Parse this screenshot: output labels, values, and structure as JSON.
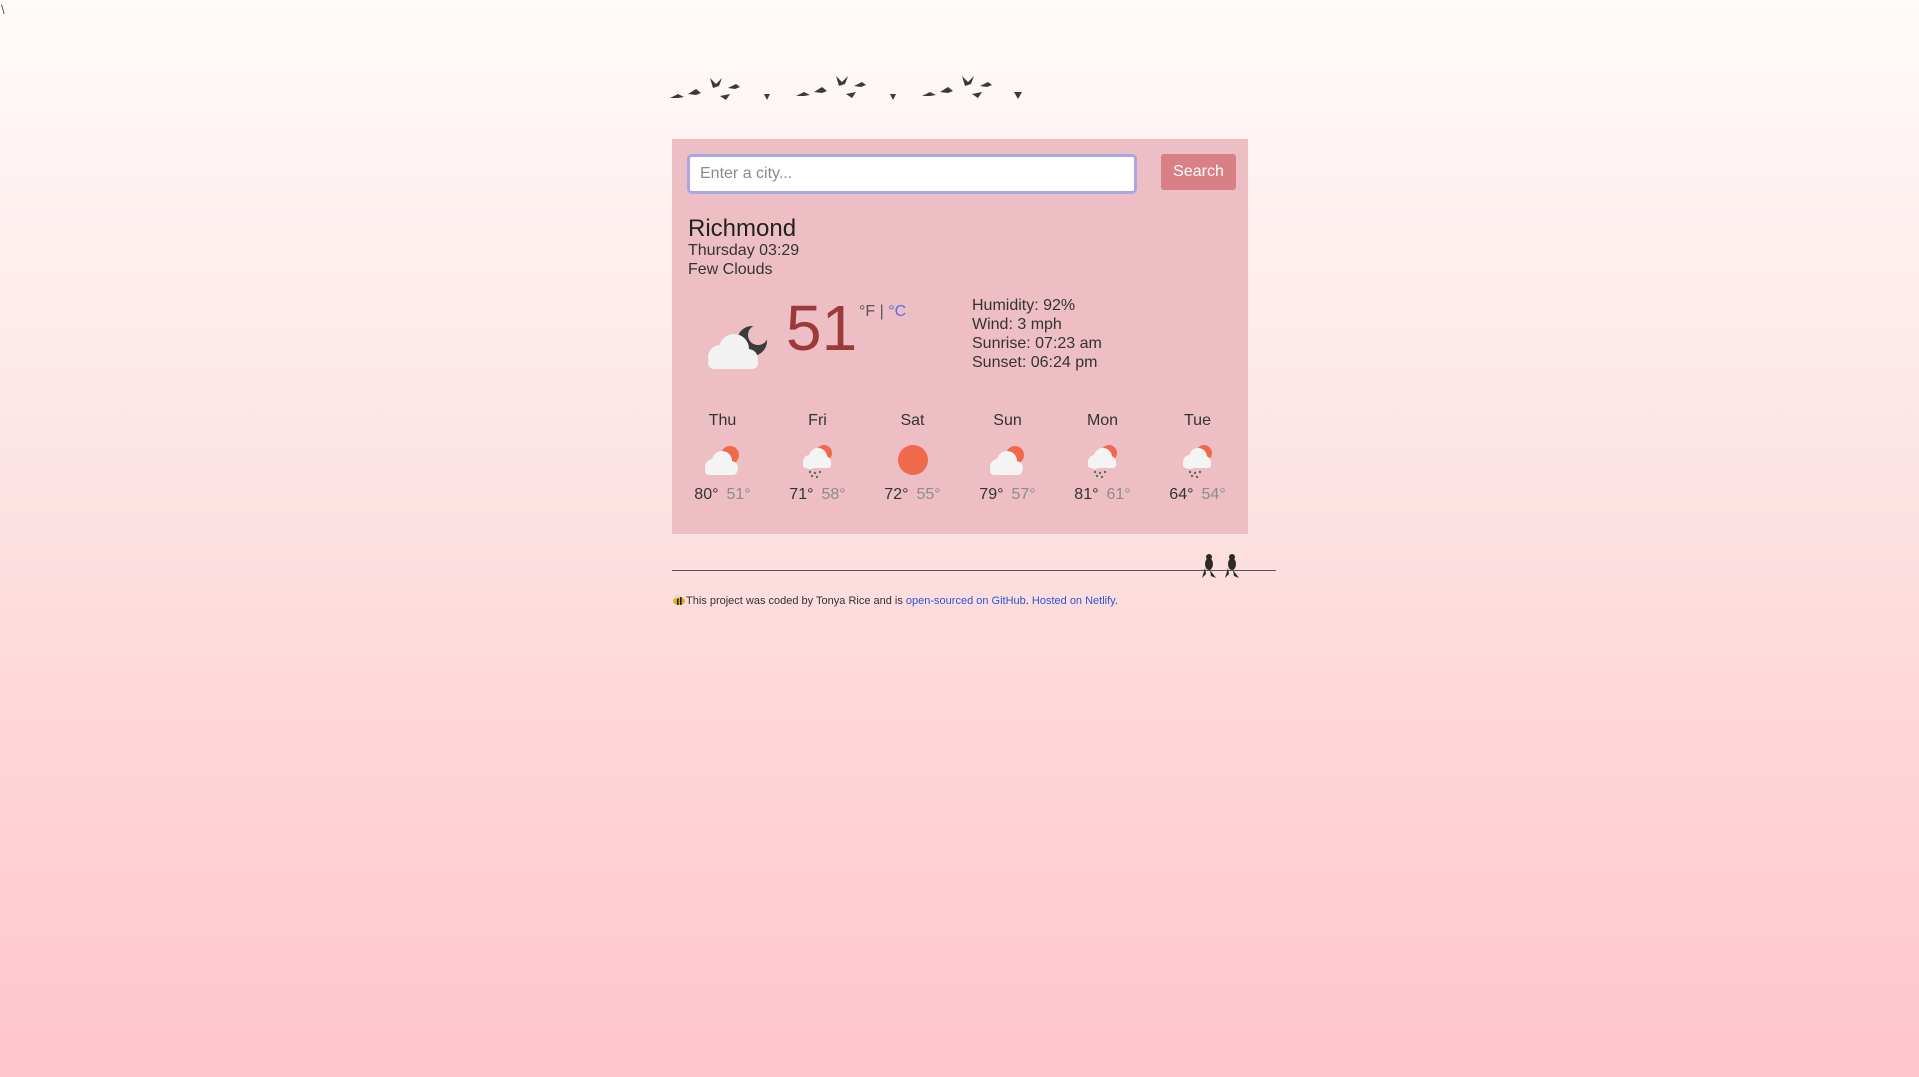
{
  "corner_char": "\\",
  "search": {
    "placeholder": "Enter a city...",
    "value": "",
    "button_label": "Search"
  },
  "current": {
    "city": "Richmond",
    "datetime": "Thursday 03:29",
    "description": "Few Clouds",
    "temperature": "51",
    "unit_f": "°F",
    "unit_separator": "|",
    "unit_c": "°C",
    "icon": "partly-cloudy-night-icon",
    "humidity": "Humidity: 92%",
    "wind": "Wind: 3 mph",
    "sunrise": "Sunrise: 07:23 am",
    "sunset": "Sunset: 06:24 pm"
  },
  "forecast": [
    {
      "day": "Thu",
      "icon": "partly-cloudy-icon",
      "max": "80°",
      "min": "51°"
    },
    {
      "day": "Fri",
      "icon": "rain-icon",
      "max": "71°",
      "min": "58°"
    },
    {
      "day": "Sat",
      "icon": "sun-icon",
      "max": "72°",
      "min": "55°"
    },
    {
      "day": "Sun",
      "icon": "partly-cloudy-icon",
      "max": "79°",
      "min": "57°"
    },
    {
      "day": "Mon",
      "icon": "rain-icon",
      "max": "81°",
      "min": "61°"
    },
    {
      "day": "Tue",
      "icon": "rain-icon",
      "max": "64°",
      "min": "54°"
    }
  ],
  "footer": {
    "text_before": "This project was coded by Tonya Rice and is ",
    "github_link": "open-sourced on GitHub",
    "middle": ". ",
    "netlify_link": "Hosted on Netlify",
    "end": "."
  },
  "colors": {
    "card_bg": "#edbfc4",
    "button_bg": "#d97f86",
    "temperature": "#9b3a3a",
    "link": "#2a55d6",
    "sun": "#ee6a4a",
    "input_border": "#a9a7e6"
  }
}
